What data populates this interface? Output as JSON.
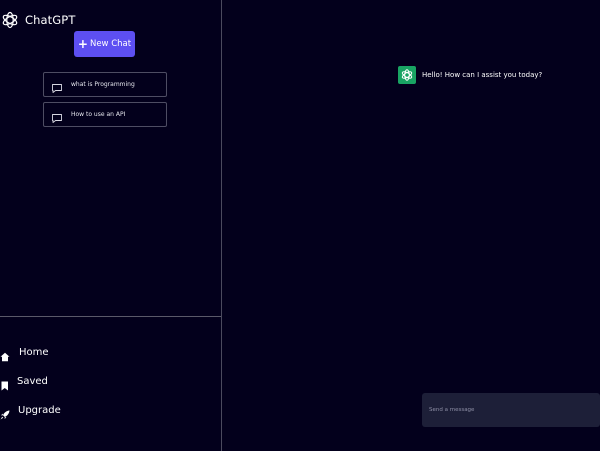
{
  "sidebar": {
    "brand": {
      "title": "ChatGPT",
      "icon": "openai-logo-icon"
    },
    "new_chat": {
      "label": "New Chat",
      "icon": "plus-icon"
    },
    "history": [
      {
        "label": "what is Programming",
        "icon": "message-square-icon"
      },
      {
        "label": "How to use an API",
        "icon": "message-square-icon"
      }
    ],
    "nav": [
      {
        "label": "Home",
        "icon": "home-icon"
      },
      {
        "label": "Saved",
        "icon": "bookmark-icon"
      },
      {
        "label": "Upgrade",
        "icon": "rocket-icon"
      }
    ]
  },
  "main": {
    "messages": [
      {
        "sender": "bot",
        "text": "Hello! How can I assist you today?",
        "avatar_icon": "openai-logo-icon"
      }
    ],
    "composer": {
      "placeholder": "Send a message",
      "value": ""
    }
  },
  "colors": {
    "background": "#03001c",
    "accent": "#5d4ff2",
    "bot_avatar": "#19a463",
    "composer_bg": "#1d1f38",
    "border": "#4e4d63"
  }
}
